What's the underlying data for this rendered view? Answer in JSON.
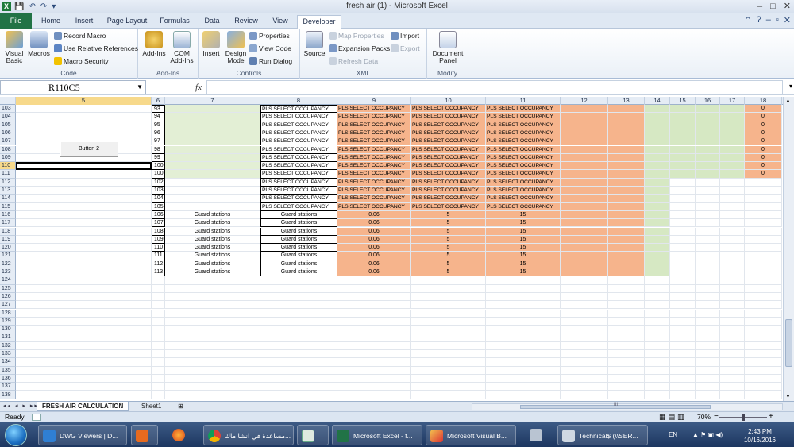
{
  "window": {
    "title": "fresh air (1)  -  Microsoft Excel",
    "app_icon_label": "X",
    "qat": [
      "💾",
      "↶",
      "↷",
      "▾"
    ],
    "controls": [
      "–",
      "□",
      "✕"
    ]
  },
  "ribbon": {
    "tabs": [
      "File",
      "Home",
      "Insert",
      "Page Layout",
      "Formulas",
      "Data",
      "Review",
      "View",
      "Developer"
    ],
    "active_tab": "Developer",
    "groups": {
      "code": {
        "label": "Code",
        "visual_basic": "Visual Basic",
        "macros": "Macros",
        "record_macro": "Record Macro",
        "use_relative": "Use Relative References",
        "macro_security": "Macro Security"
      },
      "addins": {
        "label": "Add-Ins",
        "add_ins": "Add-Ins",
        "com_add_ins": "COM Add-Ins"
      },
      "controls": {
        "label": "Controls",
        "insert": "Insert",
        "design_mode": "Design Mode",
        "properties": "Properties",
        "view_code": "View Code",
        "run_dialog": "Run Dialog"
      },
      "xml": {
        "label": "XML",
        "source": "Source",
        "map_properties": "Map Properties",
        "expansion_packs": "Expansion Packs",
        "refresh_data": "Refresh Data",
        "import": "Import",
        "export": "Export"
      },
      "modify": {
        "label": "Modify",
        "document_panel": "Document Panel"
      }
    }
  },
  "formula_bar": {
    "name_box": "R110C5",
    "fx": "fx",
    "value": ""
  },
  "columns": [
    "5",
    "6",
    "7",
    "8",
    "9",
    "10",
    "11",
    "12",
    "13",
    "14",
    "15",
    "16",
    "17",
    "18"
  ],
  "row_numbers": [
    "103",
    "104",
    "105",
    "106",
    "107",
    "108",
    "109",
    "110",
    "111",
    "112",
    "113",
    "114",
    "115",
    "116",
    "117",
    "118",
    "119",
    "120",
    "121",
    "122",
    "123",
    "124",
    "125",
    "126",
    "127",
    "128",
    "129",
    "130",
    "131",
    "132",
    "133",
    "134",
    "135",
    "136",
    "137",
    "138"
  ],
  "selected_row": "110",
  "selected_col": "5",
  "button2_label": "Button 2",
  "cells": {
    "col6": [
      "93",
      "94",
      "95",
      "96",
      "97",
      "98",
      "99",
      "100",
      "100",
      "102",
      "103",
      "104",
      "105",
      "106",
      "107",
      "108",
      "109",
      "110",
      "111",
      "112",
      "113"
    ],
    "col7_guard": "Guard stations",
    "col8_pls": "PLS SELECT OCCUPANCY",
    "col8_guard": "Guard stations",
    "col9_pls": "PLS SELECT OCCUPANCY",
    "col10_pls": "PLS SELECT OCCUPANCY",
    "col11_pls": "PLS SELECT OCCUPANCY",
    "val9": "0.06",
    "val10": "5",
    "val11": "15",
    "col18": "0"
  },
  "sheets": [
    "FRESH AIR CALCULATION",
    "Sheet1"
  ],
  "active_sheet": "FRESH AIR CALCULATION",
  "status": {
    "ready": "Ready",
    "zoom": "70%",
    "minus": "−",
    "plus": "+",
    "nav": "◂◂ ◂ ▸ ▸▸",
    "views": "▦▤▥",
    "hscroll_mark": "III"
  },
  "taskbar": {
    "items": [
      "DWG Viewers | D...",
      "",
      "",
      "",
      "مساعدة في انشا ماك...",
      "",
      "Microsoft Excel - f...",
      "Microsoft Visual B...",
      "",
      "Technical$ (\\\\SER..."
    ],
    "lang": "EN",
    "time": "2:43 PM",
    "date": "10/16/2016"
  },
  "colors": {
    "green": "#d6e8c3",
    "orange": "#f6b48c",
    "excel_green": "#217346"
  }
}
